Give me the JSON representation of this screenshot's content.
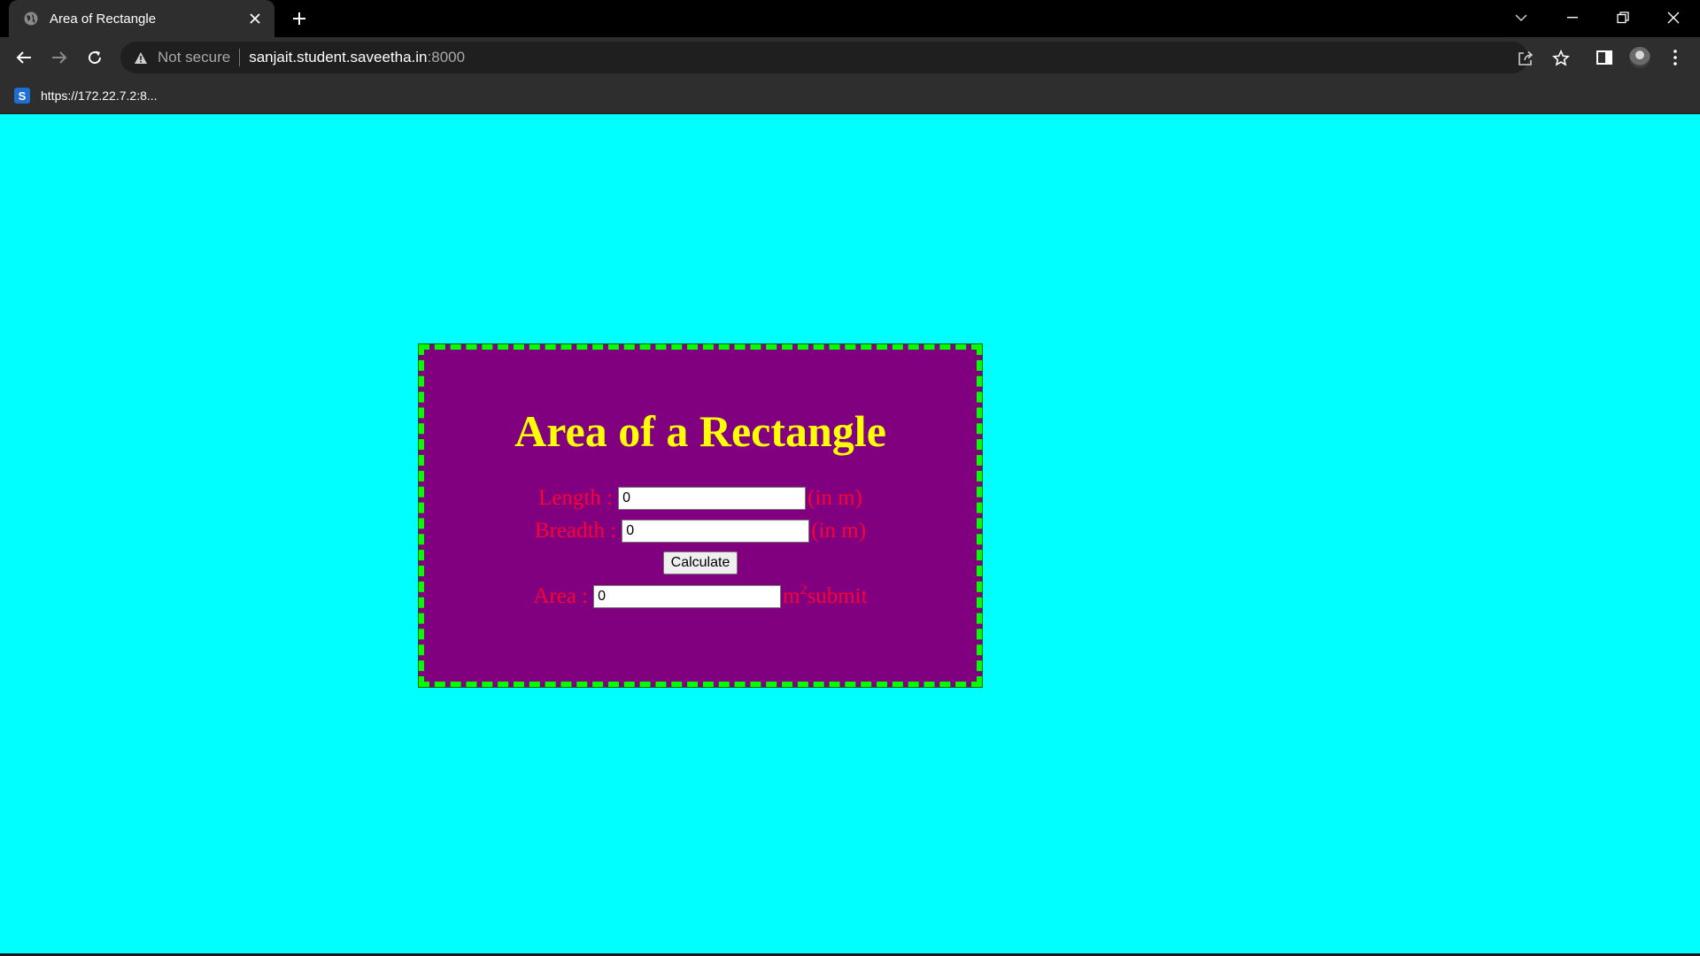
{
  "browser": {
    "tab_title": "Area of Rectangle",
    "security_label": "Not secure",
    "url_host": "sanjait.student.saveetha.in",
    "url_port": ":8000",
    "bookmark_label": "https://172.22.7.2:8...",
    "bookmark_favicon_letter": "S"
  },
  "page": {
    "background_color": "#00ffff",
    "box_color": "#800080",
    "border_color": "#00ff00",
    "title": "Area of a Rectangle",
    "length_label": "Length :",
    "length_value": "0",
    "length_unit": "(in m)",
    "breadth_label": "Breadth :",
    "breadth_value": "0",
    "breadth_unit": "(in m)",
    "calculate_label": "Calculate",
    "area_label": "Area :",
    "area_value": "0",
    "area_unit_base": "m",
    "area_unit_exp": "2",
    "area_suffix": "submit"
  }
}
